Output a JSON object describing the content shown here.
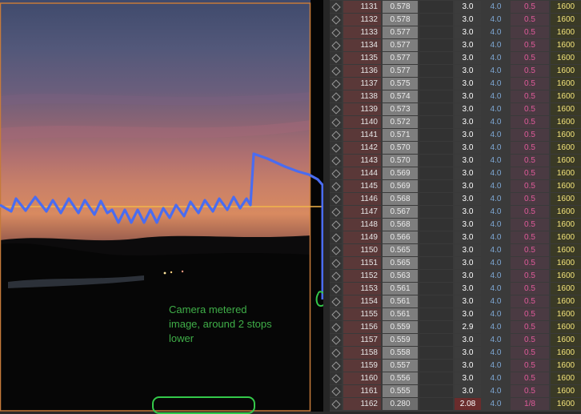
{
  "annotation": {
    "note": "Camera metered\nimage, around 2 stops\nlower",
    "line_color": "#4a6cf0",
    "note_color": "#3fae48",
    "highlight_color": "#34c94a"
  },
  "table": {
    "rows": [
      {
        "idx": "1131",
        "ev": "0.578",
        "exposure": "3.0",
        "aperture": "4.0",
        "shutter": "0.5",
        "iso": "1600"
      },
      {
        "idx": "1132",
        "ev": "0.578",
        "exposure": "3.0",
        "aperture": "4.0",
        "shutter": "0.5",
        "iso": "1600"
      },
      {
        "idx": "1133",
        "ev": "0.577",
        "exposure": "3.0",
        "aperture": "4.0",
        "shutter": "0.5",
        "iso": "1600"
      },
      {
        "idx": "1134",
        "ev": "0.577",
        "exposure": "3.0",
        "aperture": "4.0",
        "shutter": "0.5",
        "iso": "1600"
      },
      {
        "idx": "1135",
        "ev": "0.577",
        "exposure": "3.0",
        "aperture": "4.0",
        "shutter": "0.5",
        "iso": "1600"
      },
      {
        "idx": "1136",
        "ev": "0.577",
        "exposure": "3.0",
        "aperture": "4.0",
        "shutter": "0.5",
        "iso": "1600"
      },
      {
        "idx": "1137",
        "ev": "0.575",
        "exposure": "3.0",
        "aperture": "4.0",
        "shutter": "0.5",
        "iso": "1600"
      },
      {
        "idx": "1138",
        "ev": "0.574",
        "exposure": "3.0",
        "aperture": "4.0",
        "shutter": "0.5",
        "iso": "1600"
      },
      {
        "idx": "1139",
        "ev": "0.573",
        "exposure": "3.0",
        "aperture": "4.0",
        "shutter": "0.5",
        "iso": "1600"
      },
      {
        "idx": "1140",
        "ev": "0.572",
        "exposure": "3.0",
        "aperture": "4.0",
        "shutter": "0.5",
        "iso": "1600"
      },
      {
        "idx": "1141",
        "ev": "0.571",
        "exposure": "3.0",
        "aperture": "4.0",
        "shutter": "0.5",
        "iso": "1600"
      },
      {
        "idx": "1142",
        "ev": "0.570",
        "exposure": "3.0",
        "aperture": "4.0",
        "shutter": "0.5",
        "iso": "1600"
      },
      {
        "idx": "1143",
        "ev": "0.570",
        "exposure": "3.0",
        "aperture": "4.0",
        "shutter": "0.5",
        "iso": "1600"
      },
      {
        "idx": "1144",
        "ev": "0.569",
        "exposure": "3.0",
        "aperture": "4.0",
        "shutter": "0.5",
        "iso": "1600"
      },
      {
        "idx": "1145",
        "ev": "0.569",
        "exposure": "3.0",
        "aperture": "4.0",
        "shutter": "0.5",
        "iso": "1600"
      },
      {
        "idx": "1146",
        "ev": "0.568",
        "exposure": "3.0",
        "aperture": "4.0",
        "shutter": "0.5",
        "iso": "1600"
      },
      {
        "idx": "1147",
        "ev": "0.567",
        "exposure": "3.0",
        "aperture": "4.0",
        "shutter": "0.5",
        "iso": "1600"
      },
      {
        "idx": "1148",
        "ev": "0.568",
        "exposure": "3.0",
        "aperture": "4.0",
        "shutter": "0.5",
        "iso": "1600"
      },
      {
        "idx": "1149",
        "ev": "0.566",
        "exposure": "3.0",
        "aperture": "4.0",
        "shutter": "0.5",
        "iso": "1600"
      },
      {
        "idx": "1150",
        "ev": "0.565",
        "exposure": "3.0",
        "aperture": "4.0",
        "shutter": "0.5",
        "iso": "1600"
      },
      {
        "idx": "1151",
        "ev": "0.565",
        "exposure": "3.0",
        "aperture": "4.0",
        "shutter": "0.5",
        "iso": "1600"
      },
      {
        "idx": "1152",
        "ev": "0.563",
        "exposure": "3.0",
        "aperture": "4.0",
        "shutter": "0.5",
        "iso": "1600"
      },
      {
        "idx": "1153",
        "ev": "0.561",
        "exposure": "3.0",
        "aperture": "4.0",
        "shutter": "0.5",
        "iso": "1600"
      },
      {
        "idx": "1154",
        "ev": "0.561",
        "exposure": "3.0",
        "aperture": "4.0",
        "shutter": "0.5",
        "iso": "1600"
      },
      {
        "idx": "1155",
        "ev": "0.561",
        "exposure": "3.0",
        "aperture": "4.0",
        "shutter": "0.5",
        "iso": "1600"
      },
      {
        "idx": "1156",
        "ev": "0.559",
        "exposure": "2.9",
        "aperture": "4.0",
        "shutter": "0.5",
        "iso": "1600"
      },
      {
        "idx": "1157",
        "ev": "0.559",
        "exposure": "3.0",
        "aperture": "4.0",
        "shutter": "0.5",
        "iso": "1600"
      },
      {
        "idx": "1158",
        "ev": "0.558",
        "exposure": "3.0",
        "aperture": "4.0",
        "shutter": "0.5",
        "iso": "1600"
      },
      {
        "idx": "1159",
        "ev": "0.557",
        "exposure": "3.0",
        "aperture": "4.0",
        "shutter": "0.5",
        "iso": "1600"
      },
      {
        "idx": "1160",
        "ev": "0.556",
        "exposure": "3.0",
        "aperture": "4.0",
        "shutter": "0.5",
        "iso": "1600"
      },
      {
        "idx": "1161",
        "ev": "0.555",
        "exposure": "3.0",
        "aperture": "4.0",
        "shutter": "0.5",
        "iso": "1600"
      },
      {
        "idx": "1162",
        "ev": "0.280",
        "exposure": "2.08",
        "aperture": "4.0",
        "shutter": "1/8",
        "iso": "1600"
      }
    ]
  }
}
